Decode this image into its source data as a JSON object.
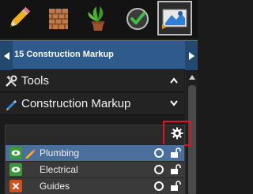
{
  "toolbar": {
    "items": [
      {
        "icon": "pencil-icon"
      },
      {
        "icon": "brick-wall-icon"
      },
      {
        "icon": "plant-icon"
      },
      {
        "icon": "checkmark-icon"
      },
      {
        "icon": "construction-markup-icon",
        "active": true
      }
    ]
  },
  "nav": {
    "title": "15 Construction Markup"
  },
  "sections": {
    "tools": {
      "label": "Tools"
    },
    "markup": {
      "label": "Construction Markup"
    }
  },
  "layers": [
    {
      "label": "Plumbing",
      "visible": true,
      "selected": true
    },
    {
      "label": "Electrical",
      "visible": true,
      "selected": false
    },
    {
      "label": "Guides",
      "visible": false,
      "selected": false
    }
  ],
  "colors": {
    "nav_blue": "#2e5b8c",
    "selected_row": "#4b6f9c",
    "visible_green": "#3c9a3c",
    "hidden_orange": "#d0501f",
    "highlight_red": "#e0141e"
  }
}
